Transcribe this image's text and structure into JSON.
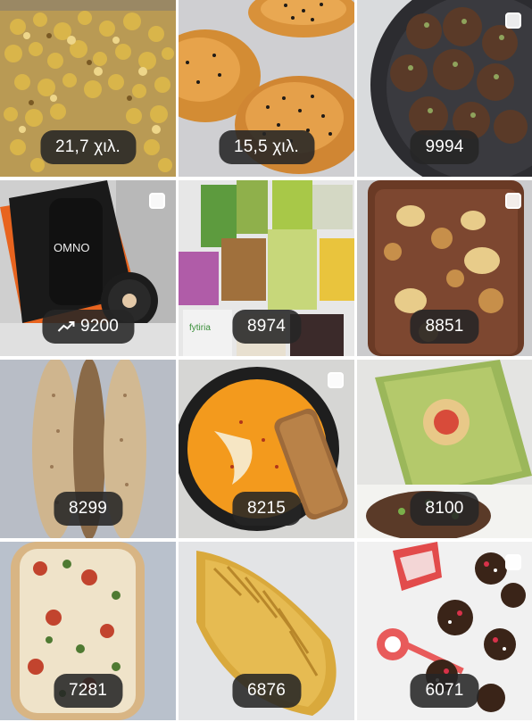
{
  "tiles": [
    {
      "label": "21,7 χιλ.",
      "trending": false,
      "select_box": false
    },
    {
      "label": "15,5 χιλ.",
      "trending": false,
      "select_box": false
    },
    {
      "label": "9994",
      "trending": false,
      "select_box": true
    },
    {
      "label": "9200",
      "trending": true,
      "select_box": true
    },
    {
      "label": "8974",
      "trending": false,
      "select_box": false
    },
    {
      "label": "8851",
      "trending": false,
      "select_box": true
    },
    {
      "label": "8299",
      "trending": false,
      "select_box": false
    },
    {
      "label": "8215",
      "trending": false,
      "select_box": true
    },
    {
      "label": "8100",
      "trending": false,
      "select_box": false
    },
    {
      "label": "7281",
      "trending": false,
      "select_box": false
    },
    {
      "label": "6876",
      "trending": false,
      "select_box": false
    },
    {
      "label": "6071",
      "trending": false,
      "select_box": true
    }
  ],
  "icons": {
    "trending": "trending-up-icon",
    "select": "checkbox-icon"
  },
  "colors": {
    "badge_bg": "#262626",
    "badge_text": "#ffffff"
  }
}
